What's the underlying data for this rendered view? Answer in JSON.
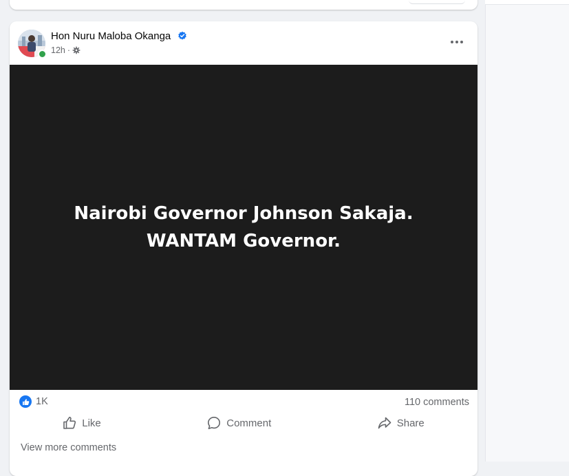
{
  "post": {
    "author_name": "Hon Nuru Maloba Okanga",
    "time": "12h",
    "separator": "·",
    "media_text": {
      "line1": "Nairobi Governor Johnson Sakaja.",
      "line2": "WANTAM Governor."
    },
    "reactions_count": "1K",
    "comments_count": "110 comments",
    "actions": {
      "like": "Like",
      "comment": "Comment",
      "share": "Share"
    },
    "view_more_comments": "View more comments"
  },
  "icons": {
    "verified": "verified-badge-icon",
    "privacy": "settings-gear-icon",
    "more": "more-horizontal-icon",
    "like": "thumbs-up-icon",
    "comment": "speech-bubble-icon",
    "share": "share-arrow-icon"
  },
  "colors": {
    "accent": "#1877f2",
    "secondary_text": "#65676b",
    "media_background": "#1c1c1c",
    "online": "#31a24c"
  }
}
